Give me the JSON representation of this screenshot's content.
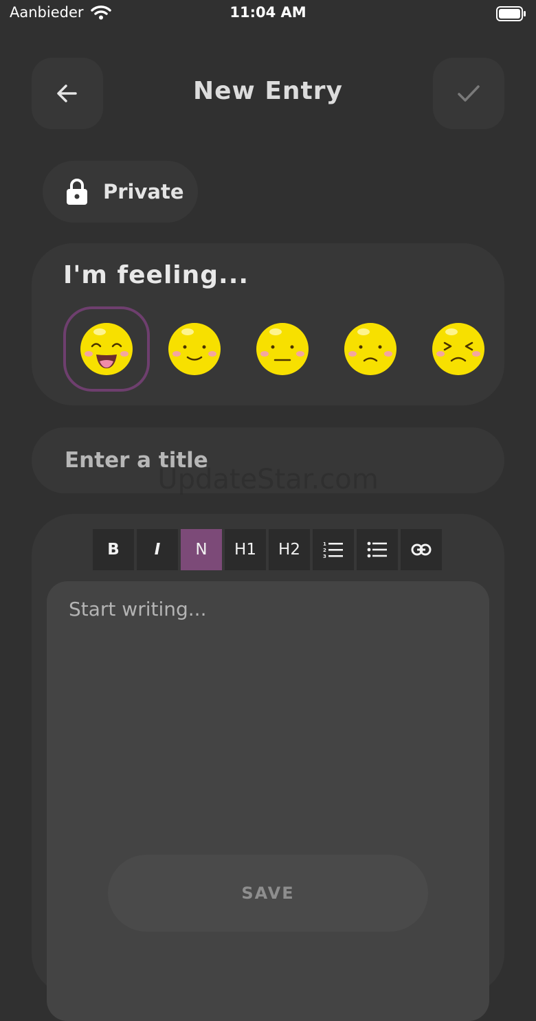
{
  "status_bar": {
    "carrier": "Aanbieder",
    "time": "11:04 AM"
  },
  "header": {
    "title": "New Entry",
    "back_icon": "arrow-left-icon",
    "confirm_icon": "checkmark-icon"
  },
  "privacy": {
    "label": "Private",
    "icon": "lock-icon"
  },
  "mood": {
    "heading": "I'm feeling...",
    "options": [
      "very-happy",
      "happy",
      "neutral",
      "sad",
      "very-sad"
    ],
    "selected": "very-happy",
    "colors": {
      "face": "#f7e000",
      "selection_ring": "#6e3f6e"
    }
  },
  "title_field": {
    "placeholder": "Enter a title",
    "value": ""
  },
  "watermark": "UpdateStar.com",
  "toolbar": {
    "bold": "B",
    "italic": "I",
    "normal": "N",
    "h1": "H1",
    "h2": "H2",
    "active": "N",
    "accent": "#7c4a78"
  },
  "body_field": {
    "placeholder": "Start writing...",
    "value": ""
  },
  "save_label": "SAVE"
}
